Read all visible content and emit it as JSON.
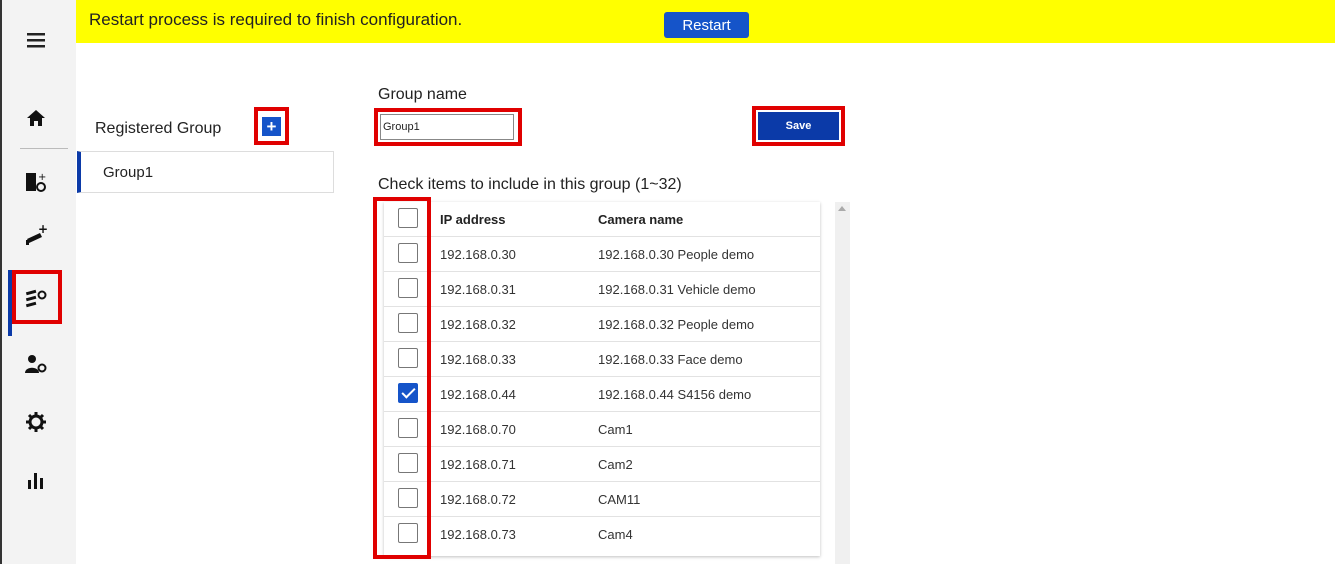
{
  "banner": {
    "message": "Restart process is required to finish configuration.",
    "restart_label": "Restart"
  },
  "sidebar": {
    "items": [
      {
        "icon": "menu-icon"
      },
      {
        "icon": "home-icon"
      },
      {
        "icon": "device-settings-icon"
      },
      {
        "icon": "add-camera-icon"
      },
      {
        "icon": "group-settings-icon",
        "active": true
      },
      {
        "icon": "user-settings-icon"
      },
      {
        "icon": "gear-icon"
      },
      {
        "icon": "statistics-icon"
      }
    ]
  },
  "registered": {
    "title": "Registered Group",
    "add_label": "+",
    "groups": [
      "Group1"
    ]
  },
  "form": {
    "group_name_label": "Group name",
    "group_name_value": "Group1",
    "save_label": "Save",
    "check_label": "Check items to include in this group (1~32)"
  },
  "table": {
    "headers": {
      "ip": "IP address",
      "name": "Camera name"
    },
    "rows": [
      {
        "ip": "192.168.0.30",
        "name": "192.168.0.30 People demo",
        "checked": false
      },
      {
        "ip": "192.168.0.31",
        "name": "192.168.0.31 Vehicle demo",
        "checked": false
      },
      {
        "ip": "192.168.0.32",
        "name": "192.168.0.32 People demo",
        "checked": false
      },
      {
        "ip": "192.168.0.33",
        "name": "192.168.0.33 Face demo",
        "checked": false
      },
      {
        "ip": "192.168.0.44",
        "name": "192.168.0.44 S4156 demo",
        "checked": true
      },
      {
        "ip": "192.168.0.70",
        "name": "Cam1",
        "checked": false
      },
      {
        "ip": "192.168.0.71",
        "name": "Cam2",
        "checked": false
      },
      {
        "ip": "192.168.0.72",
        "name": "CAM11",
        "checked": false
      },
      {
        "ip": "192.168.0.73",
        "name": "Cam4",
        "checked": false
      }
    ]
  },
  "colors": {
    "banner": "#ffff00",
    "accent": "#1554c9",
    "highlight": "#e00000"
  }
}
